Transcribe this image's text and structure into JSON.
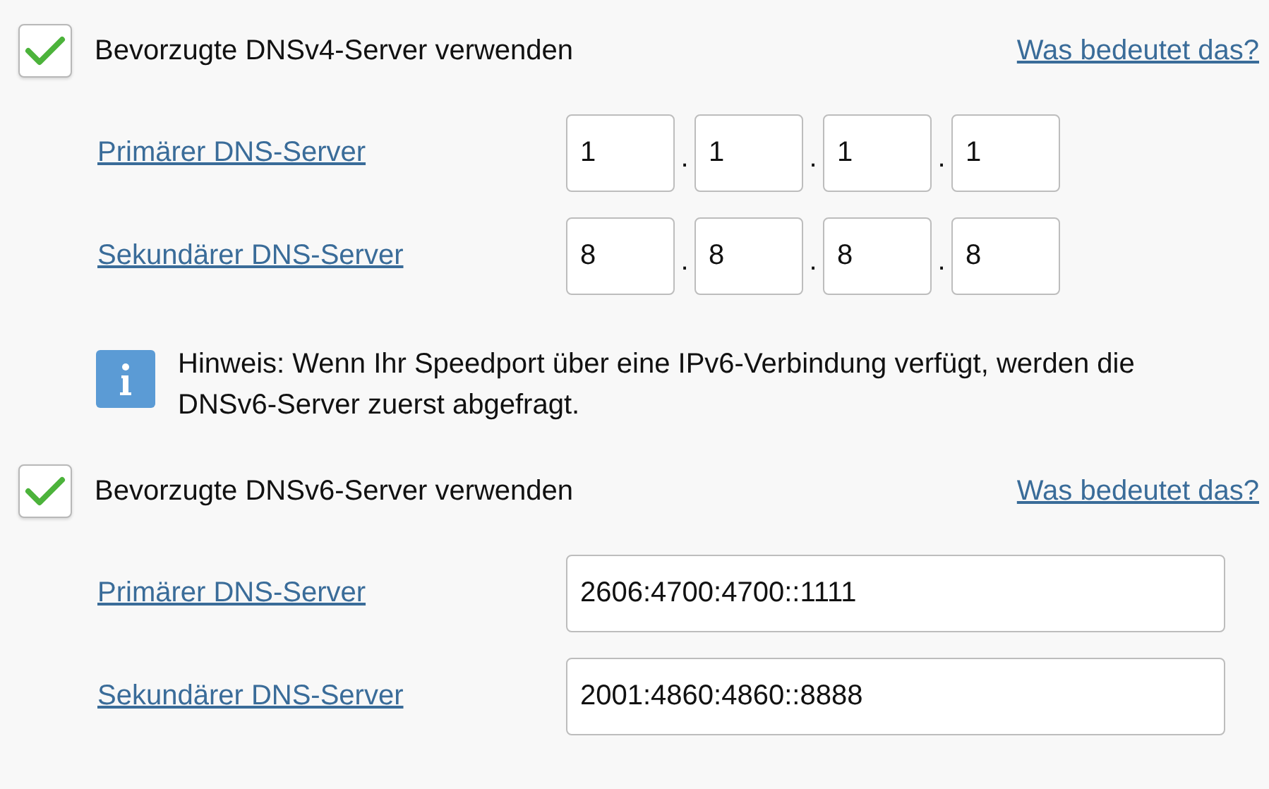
{
  "sections": [
    {
      "kind": "ipv4",
      "checked": true,
      "label": "Bevorzugte DNSv4-Server verwenden",
      "help_link": "Was bedeutet das?",
      "servers": [
        {
          "label": "Primärer DNS-Server",
          "octets": [
            "1",
            "1",
            "1",
            "1"
          ],
          "separators": [
            ".",
            ".",
            "."
          ]
        },
        {
          "label": "Sekundärer DNS-Server",
          "octets": [
            "8",
            "8",
            "8",
            "8"
          ],
          "separators": [
            ".",
            ".",
            "."
          ]
        }
      ]
    },
    {
      "kind": "note",
      "text": "Hinweis: Wenn Ihr Speedport über eine IPv6-Verbindung verfügt, werden die DNSv6-Server zuerst abgefragt."
    },
    {
      "kind": "ipv6",
      "checked": true,
      "label": "Bevorzugte DNSv6-Server verwenden",
      "help_link": "Was bedeutet das?",
      "servers": [
        {
          "label": "Primärer DNS-Server",
          "value": "2606:4700:4700::1111"
        },
        {
          "label": "Sekundärer DNS-Server",
          "value": "2001:4860:4860::8888"
        }
      ]
    }
  ]
}
